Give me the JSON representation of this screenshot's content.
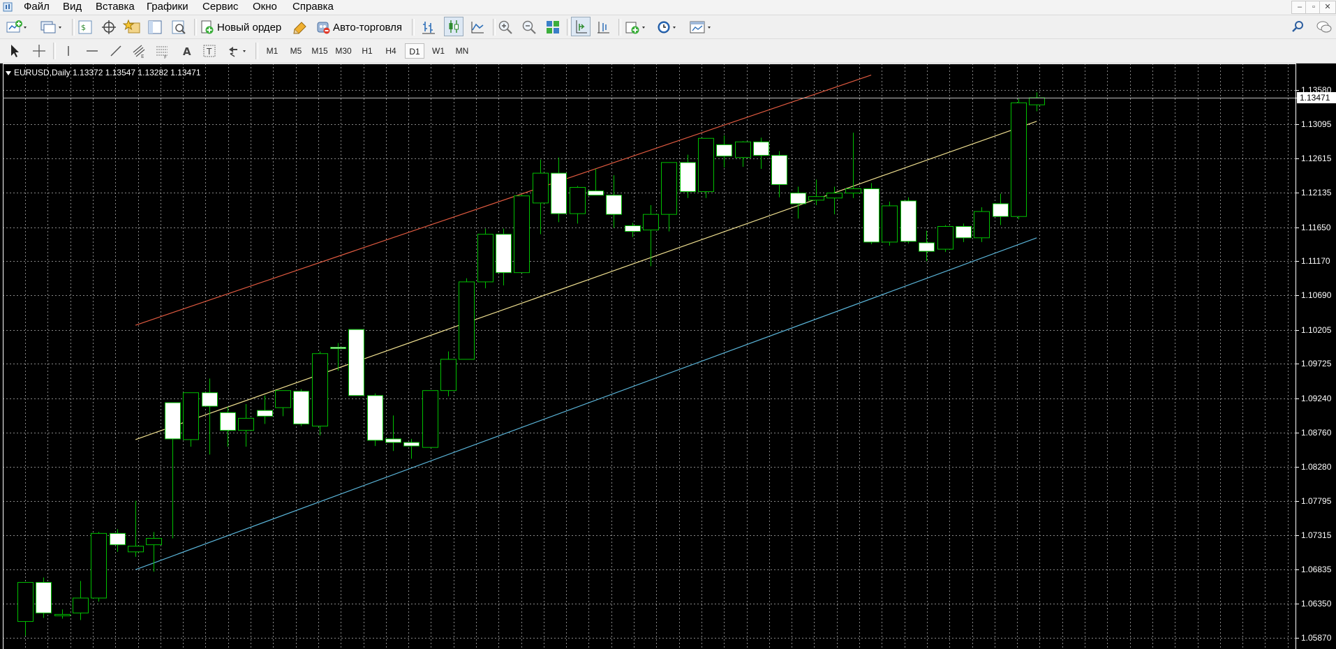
{
  "menu": {
    "items": [
      "Файл",
      "Вид",
      "Вставка",
      "Графики",
      "Сервис",
      "Окно",
      "Справка"
    ],
    "window_controls": [
      "–",
      "▫",
      "✕"
    ]
  },
  "toolbar": {
    "new_order_label": "Новый ордер",
    "autotrading_label": "Авто-торговля",
    "timeframes": [
      "M1",
      "M5",
      "M15",
      "M30",
      "H1",
      "H4",
      "D1",
      "W1",
      "MN"
    ],
    "active_timeframe": "D1"
  },
  "chart": {
    "symbol_line": "EURUSD,Daily  1.13372 1.13547 1.13282 1.13471",
    "symbol": "EURUSD",
    "period": "Daily",
    "ohlc": {
      "open": 1.13372,
      "high": 1.13547,
      "low": 1.13282,
      "close": 1.13471
    },
    "current_price_label": "1.13471",
    "current_price": 1.13471,
    "price_labels": [
      "1.13580",
      "1.13095",
      "1.12615",
      "1.12135",
      "1.11650",
      "1.11170",
      "1.10690",
      "1.10205",
      "1.09725",
      "1.09240",
      "1.08760",
      "1.08280",
      "1.07795",
      "1.07315",
      "1.06835",
      "1.06350",
      "1.05870"
    ],
    "colors": {
      "background": "#000000",
      "grid": "#c0c0c0",
      "candle_outline": "#00c000",
      "bull_body": "#000000",
      "bear_body": "#ffffff",
      "channel_upper": "#e05a40",
      "channel_middle": "#f0e090",
      "channel_lower": "#5ab4d8"
    }
  },
  "chart_data": {
    "type": "candlestick",
    "symbol": "EURUSD",
    "timeframe": "Daily",
    "ylim": [
      1.0579,
      1.1379
    ],
    "grid": true,
    "candles": [
      {
        "o": 1.061,
        "h": 1.064,
        "l": 1.059,
        "c": 1.0665
      },
      {
        "o": 1.0665,
        "h": 1.0672,
        "l": 1.0615,
        "c": 1.0622
      },
      {
        "o": 1.0619,
        "h": 1.0627,
        "l": 1.0614,
        "c": 1.062
      },
      {
        "o": 1.0622,
        "h": 1.0667,
        "l": 1.0612,
        "c": 1.0643
      },
      {
        "o": 1.0643,
        "h": 1.0736,
        "l": 1.0638,
        "c": 1.0734
      },
      {
        "o": 1.0734,
        "h": 1.074,
        "l": 1.0708,
        "c": 1.0718
      },
      {
        "o": 1.0708,
        "h": 1.078,
        "l": 1.0701,
        "c": 1.0716
      },
      {
        "o": 1.0718,
        "h": 1.0736,
        "l": 1.068,
        "c": 1.0727
      },
      {
        "o": 1.0918,
        "h": 1.0918,
        "l": 1.0727,
        "c": 1.0867
      },
      {
        "o": 1.0866,
        "h": 1.0932,
        "l": 1.0856,
        "c": 1.0932
      },
      {
        "o": 1.0932,
        "h": 1.0952,
        "l": 1.0845,
        "c": 1.0913
      },
      {
        "o": 1.0904,
        "h": 1.0912,
        "l": 1.0856,
        "c": 1.0879
      },
      {
        "o": 1.0879,
        "h": 1.0916,
        "l": 1.0856,
        "c": 1.0896
      },
      {
        "o": 1.0907,
        "h": 1.0928,
        "l": 1.0888,
        "c": 1.0899
      },
      {
        "o": 1.0911,
        "h": 1.0934,
        "l": 1.0899,
        "c": 1.0935
      },
      {
        "o": 1.0934,
        "h": 1.0937,
        "l": 1.0885,
        "c": 1.0888
      },
      {
        "o": 1.0885,
        "h": 1.099,
        "l": 1.0872,
        "c": 1.0987
      },
      {
        "o": 1.0996,
        "h": 1.1002,
        "l": 1.0963,
        "c": 1.0994
      },
      {
        "o": 1.1021,
        "h": 1.1021,
        "l": 1.0928,
        "c": 1.0928
      },
      {
        "o": 1.0928,
        "h": 1.0931,
        "l": 1.0857,
        "c": 1.0865
      },
      {
        "o": 1.0867,
        "h": 1.09,
        "l": 1.085,
        "c": 1.0862
      },
      {
        "o": 1.0862,
        "h": 1.0867,
        "l": 1.0839,
        "c": 1.0857
      },
      {
        "o": 1.0855,
        "h": 1.0935,
        "l": 1.0855,
        "c": 1.0935
      },
      {
        "o": 1.0935,
        "h": 1.099,
        "l": 1.0927,
        "c": 1.0979
      },
      {
        "o": 1.0979,
        "h": 1.1093,
        "l": 1.0979,
        "c": 1.1088
      },
      {
        "o": 1.1088,
        "h": 1.1163,
        "l": 1.1079,
        "c": 1.1155
      },
      {
        "o": 1.1155,
        "h": 1.1163,
        "l": 1.1083,
        "c": 1.1101
      },
      {
        "o": 1.1101,
        "h": 1.1211,
        "l": 1.1101,
        "c": 1.1209
      },
      {
        "o": 1.1199,
        "h": 1.126,
        "l": 1.1155,
        "c": 1.1241
      },
      {
        "o": 1.1241,
        "h": 1.1263,
        "l": 1.1172,
        "c": 1.1184
      },
      {
        "o": 1.1184,
        "h": 1.1223,
        "l": 1.117,
        "c": 1.1221
      },
      {
        "o": 1.1216,
        "h": 1.1247,
        "l": 1.121,
        "c": 1.121
      },
      {
        "o": 1.121,
        "h": 1.1238,
        "l": 1.1164,
        "c": 1.1183
      },
      {
        "o": 1.1167,
        "h": 1.1171,
        "l": 1.1151,
        "c": 1.1159
      },
      {
        "o": 1.1161,
        "h": 1.1196,
        "l": 1.111,
        "c": 1.1183
      },
      {
        "o": 1.1183,
        "h": 1.1256,
        "l": 1.1159,
        "c": 1.1256
      },
      {
        "o": 1.1256,
        "h": 1.1267,
        "l": 1.1206,
        "c": 1.1215
      },
      {
        "o": 1.1215,
        "h": 1.129,
        "l": 1.1206,
        "c": 1.129
      },
      {
        "o": 1.1281,
        "h": 1.1294,
        "l": 1.1249,
        "c": 1.1265
      },
      {
        "o": 1.1263,
        "h": 1.1286,
        "l": 1.125,
        "c": 1.1285
      },
      {
        "o": 1.1285,
        "h": 1.1291,
        "l": 1.1247,
        "c": 1.1266
      },
      {
        "o": 1.1266,
        "h": 1.1272,
        "l": 1.1207,
        "c": 1.1225
      },
      {
        "o": 1.1213,
        "h": 1.1222,
        "l": 1.1177,
        "c": 1.1198
      },
      {
        "o": 1.1203,
        "h": 1.1232,
        "l": 1.1196,
        "c": 1.1208
      },
      {
        "o": 1.1206,
        "h": 1.1222,
        "l": 1.1183,
        "c": 1.1213
      },
      {
        "o": 1.1213,
        "h": 1.1298,
        "l": 1.1206,
        "c": 1.1219
      },
      {
        "o": 1.1219,
        "h": 1.1227,
        "l": 1.1141,
        "c": 1.1144
      },
      {
        "o": 1.1144,
        "h": 1.1201,
        "l": 1.1139,
        "c": 1.1195
      },
      {
        "o": 1.1202,
        "h": 1.1207,
        "l": 1.1142,
        "c": 1.1145
      },
      {
        "o": 1.1143,
        "h": 1.116,
        "l": 1.1117,
        "c": 1.1131
      },
      {
        "o": 1.1134,
        "h": 1.1168,
        "l": 1.113,
        "c": 1.1166
      },
      {
        "o": 1.1166,
        "h": 1.117,
        "l": 1.1144,
        "c": 1.115
      },
      {
        "o": 1.115,
        "h": 1.1193,
        "l": 1.1144,
        "c": 1.1187
      },
      {
        "o": 1.1198,
        "h": 1.1212,
        "l": 1.1168,
        "c": 1.118
      },
      {
        "o": 1.118,
        "h": 1.1346,
        "l": 1.1176,
        "c": 1.134
      },
      {
        "o": 1.13372,
        "h": 1.13547,
        "l": 1.13282,
        "c": 1.13471
      }
    ],
    "channel_lines": [
      {
        "name": "upper",
        "color": "#e05a40",
        "from": {
          "bar": 6,
          "price": 1.1027
        },
        "to": {
          "bar": 46,
          "price": 1.1379
        }
      },
      {
        "name": "middle",
        "color": "#f0e090",
        "from": {
          "bar": 6,
          "price": 1.0866
        },
        "to": {
          "bar": 55,
          "price": 1.1314
        }
      },
      {
        "name": "lower",
        "color": "#5ab4d8",
        "from": {
          "bar": 6,
          "price": 1.0683
        },
        "to": {
          "bar": 55,
          "price": 1.115
        }
      }
    ]
  }
}
